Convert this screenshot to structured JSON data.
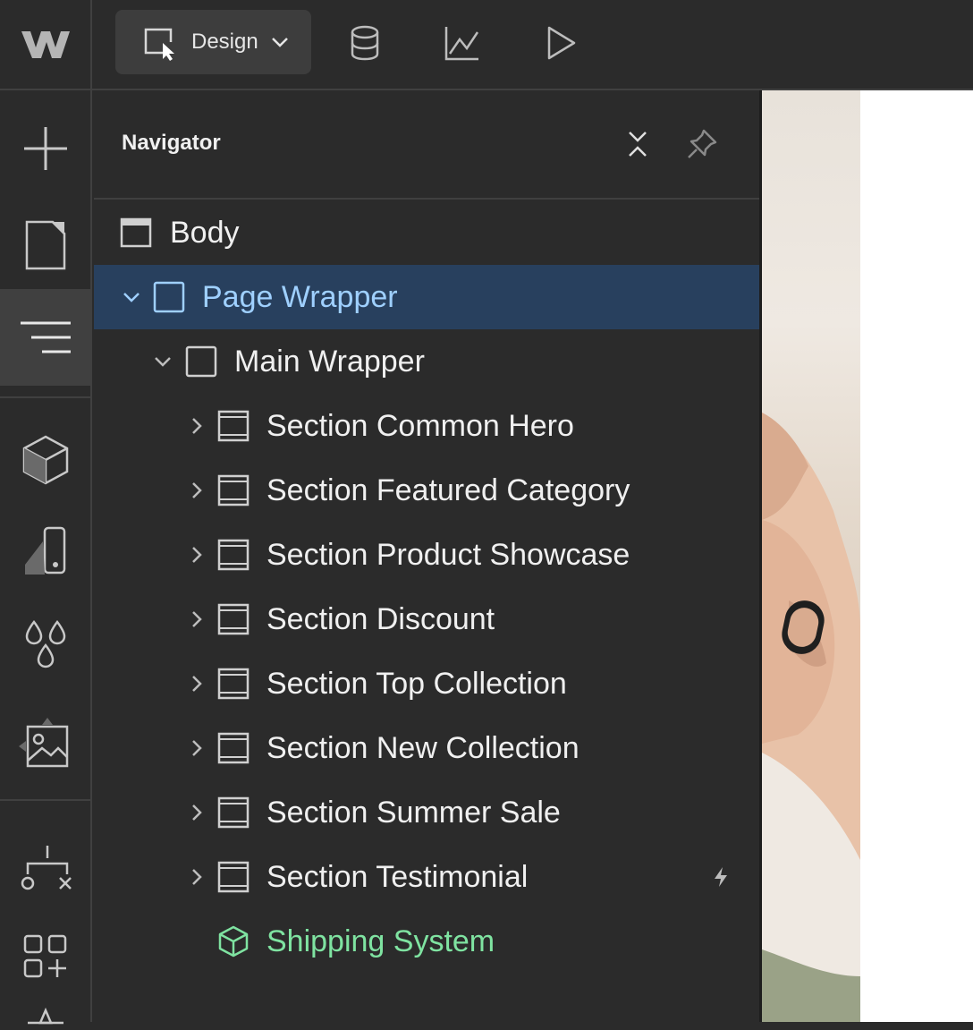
{
  "toolbar": {
    "mode_label": "Design",
    "icons": [
      "webflow-logo-icon",
      "design-mode-icon",
      "chevron-down-icon",
      "cms-database-icon",
      "analytics-icon",
      "preview-play-icon"
    ]
  },
  "leftbar": {
    "items": [
      "add-icon",
      "pages-icon",
      "navigator-icon",
      "components-icon",
      "style-selectors-icon",
      "variables-icon",
      "assets-icon",
      "logic-icon",
      "apps-icon",
      "more-icon"
    ],
    "active": "navigator-icon"
  },
  "navigator": {
    "title": "Navigator",
    "tree": [
      {
        "label": "Body",
        "level": 0
      },
      {
        "label": "Page Wrapper",
        "level": 1,
        "selected": true
      },
      {
        "label": "Main Wrapper",
        "level": 2
      },
      {
        "label": "Section Common Hero",
        "level": 3
      },
      {
        "label": "Section Featured Category",
        "level": 3
      },
      {
        "label": "Section Product Showcase",
        "level": 3
      },
      {
        "label": "Section Discount",
        "level": 3
      },
      {
        "label": "Section Top Collection",
        "level": 3
      },
      {
        "label": "Section New Collection",
        "level": 3
      },
      {
        "label": "Section Summer Sale",
        "level": 3
      },
      {
        "label": "Section Testimonial",
        "level": 3,
        "interaction": true
      },
      {
        "label": "Shipping System",
        "level": 3,
        "component": true
      }
    ]
  },
  "colors": {
    "selected_bg": "#28405e",
    "selected_text": "#9fd0ff",
    "component_text": "#7fe3a1"
  }
}
